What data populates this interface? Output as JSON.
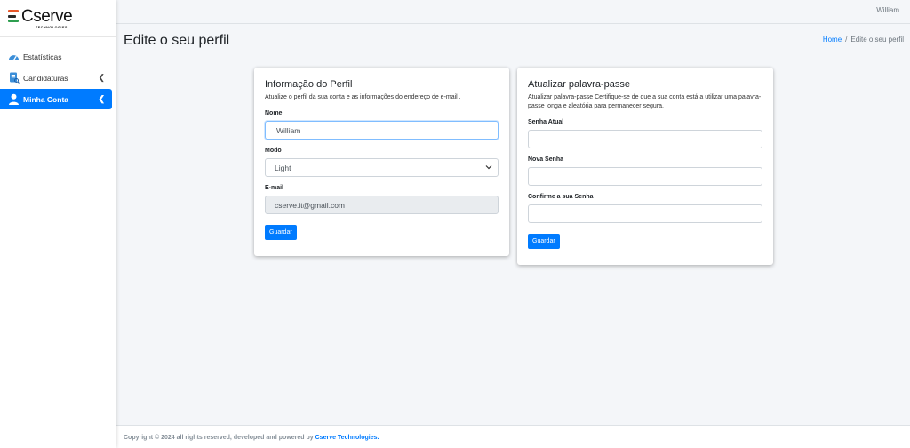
{
  "brand": {
    "name": "Cserve",
    "tagline": "TECHNOLOGIES",
    "colors": [
      "#e8572a",
      "#2a2a2a",
      "#2e9e4f"
    ]
  },
  "sidebar": {
    "items": [
      {
        "label": "Estatísticas",
        "icon": "dashboard-gauge-icon",
        "expandable": false,
        "active": false
      },
      {
        "label": "Candidaturas",
        "icon": "document-search-icon",
        "expandable": true,
        "active": false
      },
      {
        "label": "Minha Conta",
        "icon": "user-icon",
        "expandable": true,
        "active": true
      }
    ]
  },
  "header": {
    "user_name": "William"
  },
  "page": {
    "title": "Edite o seu perfil",
    "breadcrumb": {
      "home": "Home",
      "separator": "/",
      "current": "Edite o seu perfil"
    }
  },
  "profile_card": {
    "title": "Informação do Perfil",
    "description": "Atualize o perfil da sua conta e as informações do endereço de e-mail .",
    "name_label": "Nome",
    "name_value": "William",
    "mode_label": "Modo",
    "mode_value": "Light",
    "email_label": "E-mail",
    "email_value": "cserve.it@gmail.com",
    "save_label": "Guardar"
  },
  "password_card": {
    "title": "Atualizar palavra-passe",
    "description": "Atualizar palavra-passe Certifique-se de que a sua conta está a utilizar uma palavra-passe longa e aleatória para permanecer segura.",
    "current_label": "Senha Atual",
    "new_label": "Nova Senha",
    "confirm_label": "Confirme a sua Senha",
    "save_label": "Guardar"
  },
  "footer": {
    "text": "Copyright © 2024 all rights reserved, developed and powered by",
    "link": "Cserve Technologies."
  },
  "colors": {
    "primary": "#007bff",
    "background": "#f4f6f9",
    "sidebar": "#ffffff"
  }
}
